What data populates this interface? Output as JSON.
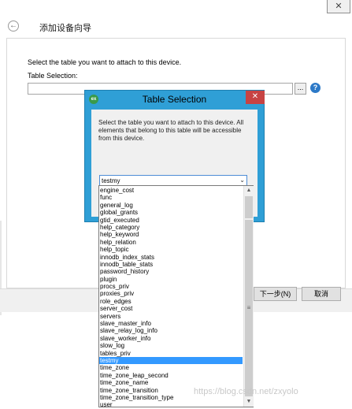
{
  "wizard": {
    "title": "添加设备向导",
    "close_glyph": "✕",
    "back_glyph": "←",
    "instruction": "Select the table you want to attach to this device.",
    "table_label": "Table Selection:",
    "table_value": "",
    "browse_label": "...",
    "help_glyph": "?",
    "next_label": "下一步(N)",
    "cancel_label": "取消"
  },
  "dialog": {
    "title": "Table Selection",
    "icon_text": "ex",
    "close_glyph": "✕",
    "text": "Select the table you want to attach to this device. All elements that belong to this table will be accessible from this device.",
    "selected_value": "testmy",
    "combo_arrow": "⌄"
  },
  "dropdown": {
    "items": [
      "engine_cost",
      "func",
      "general_log",
      "global_grants",
      "gtid_executed",
      "help_category",
      "help_keyword",
      "help_relation",
      "help_topic",
      "innodb_index_stats",
      "innodb_table_stats",
      "password_history",
      "plugin",
      "procs_priv",
      "proxies_priv",
      "role_edges",
      "server_cost",
      "servers",
      "slave_master_info",
      "slave_relay_log_info",
      "slave_worker_info",
      "slow_log",
      "tables_priv",
      "testmy",
      "time_zone",
      "time_zone_leap_second",
      "time_zone_name",
      "time_zone_transition",
      "time_zone_transition_type",
      "user"
    ],
    "selected_index": 23,
    "scroll_up_glyph": "▲",
    "scroll_down_glyph": "▼",
    "grip_glyph": "≡"
  },
  "watermark": "https://blog.csdn.net/zxyolo",
  "colors": {
    "dialog_frame": "#2f9fd6",
    "close_button": "#c74343",
    "selection": "#3399ff"
  }
}
